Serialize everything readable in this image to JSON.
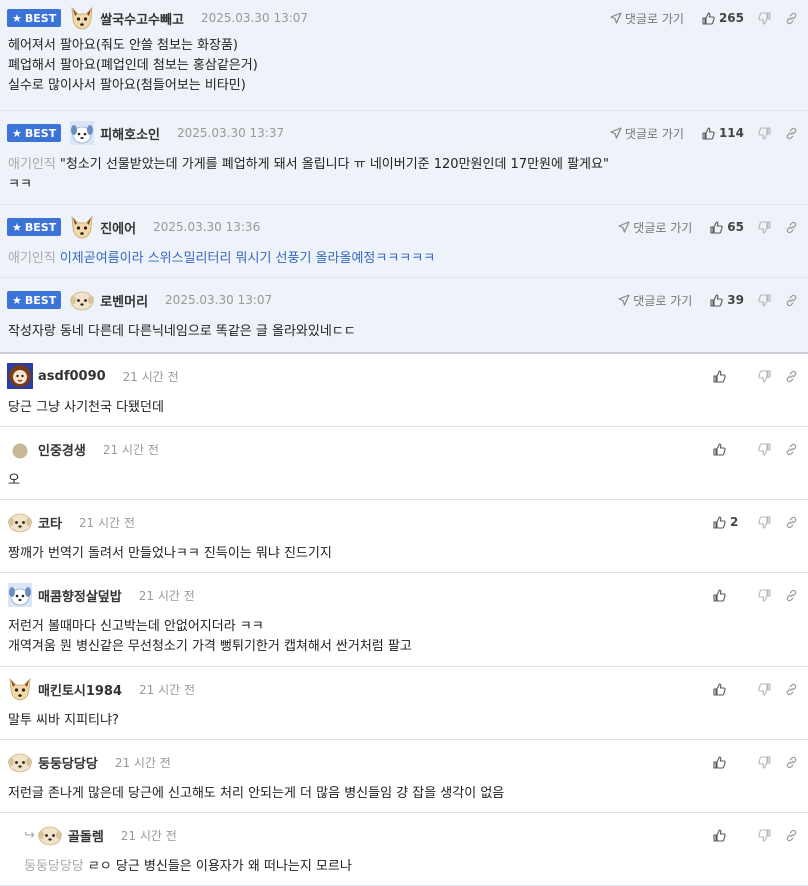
{
  "ui": {
    "best_label": "BEST",
    "reply_link_label": "댓글로 가기",
    "accent_color": "#3b73d9",
    "best_bg_color": "#eef2f9"
  },
  "comments": [
    {
      "type": "best",
      "avatar": "fox-icon",
      "nick": "쌀국수고수빼고",
      "date": "2025.03.30 13:07",
      "likes": "265",
      "lines": [
        "헤어져서 팔아요(줘도 안쓸 첨보는 화장품)",
        "폐업해서 팔아요(폐업인데 첨보는 홍삼같은거)",
        "실수로 많이사서 팔아요(첨들어보는 비타민)"
      ]
    },
    {
      "type": "best",
      "avatar": "dog-icon",
      "nick": "피해호소인",
      "date": "2025.03.30 13:37",
      "likes": "114",
      "tag": "애기인직",
      "lines": [
        "\"청소기 선물받았는데 가게를 폐업하게 돼서 올립니다 ㅠ 네이버기준 120만원인데 17만원에 팔게요\"",
        "ㅋㅋ"
      ]
    },
    {
      "type": "best",
      "avatar": "fox-icon",
      "nick": "진에어",
      "date": "2025.03.30 13:36",
      "likes": "65",
      "tag": "애기인직",
      "blue_text": "이제곧여름이라 스위스밀리터리 뭐시기 선풍기 올라올예정ㅋㅋㅋㅋㅋ"
    },
    {
      "type": "best",
      "avatar": "puppy-icon",
      "nick": "로벤머리",
      "date": "2025.03.30 13:07",
      "likes": "39",
      "lines": [
        "작성자랑 동네 다른데 다른닉네임으로 똑같은 글 올라와있네ㄷㄷ"
      ]
    },
    {
      "type": "normal",
      "avatar": "lion-icon",
      "nick": "asdf0090",
      "date": "21 시간 전",
      "likes": "",
      "lines": [
        "당근 그냥 사기천국 다됐던데"
      ]
    },
    {
      "type": "normal",
      "avatar": "circle-icon",
      "nick": "인중경생",
      "date": "21 시간 전",
      "likes": "",
      "lines": [
        "오"
      ]
    },
    {
      "type": "normal",
      "avatar": "puppy-icon",
      "nick": "코타",
      "date": "21 시간 전",
      "likes": "2",
      "lines": [
        "짱깨가 번역기 돌려서 만들었나ㅋㅋ 진득이는 뭐냐 진드기지"
      ]
    },
    {
      "type": "normal",
      "avatar": "dog-icon",
      "nick": "매콤향정살덮밥",
      "date": "21 시간 전",
      "likes": "",
      "lines": [
        "저런거 볼때마다 신고박는데 안없어지더라 ㅋㅋ",
        "개역겨움 뭔 병신같은 무선청소기 가격 뻥튀기한거 캡쳐해서 싼거처럼 팔고"
      ]
    },
    {
      "type": "normal",
      "avatar": "fox-icon",
      "nick": "매킨토시1984",
      "date": "21 시간 전",
      "likes": "",
      "lines": [
        "말투 씨바 지피티냐?"
      ]
    },
    {
      "type": "normal",
      "avatar": "puppy-icon",
      "nick": "둥둥당당당",
      "date": "21 시간 전",
      "likes": "",
      "lines": [
        "저런글 존나게 많은데 당근에 신고해도 처리 안되는게 더 많음 병신들임 걍 잡을 생각이 없음"
      ]
    },
    {
      "type": "reply",
      "avatar": "puppy-icon",
      "nick": "골돌렘",
      "date": "21 시간 전",
      "likes": "",
      "tag": "둥둥당당당",
      "lines": [
        "ㄹㅇ 당근 병신들은 이용자가 왜 떠나는지 모르나"
      ]
    }
  ]
}
